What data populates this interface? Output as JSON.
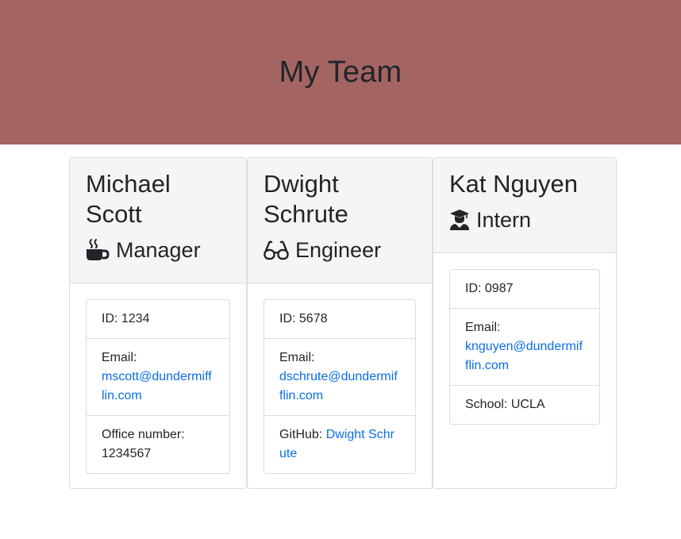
{
  "header": {
    "title": "My Team"
  },
  "employees": [
    {
      "name": "Michael Scott",
      "role": "Manager",
      "icon": "coffee-mug-icon",
      "id_text": "ID: 1234",
      "email_label": "Email:",
      "email": "mscott@dundermifflin.com",
      "extra_label": "Office number:",
      "extra_value": "1234567"
    },
    {
      "name": "Dwight Schrute",
      "role": "Engineer",
      "icon": "glasses-icon",
      "id_text": "ID: 5678",
      "email_label": "Email:",
      "email": "dschrute@dundermifflin.com",
      "extra_label": "GitHub:",
      "extra_value": "Dwight Schrute"
    },
    {
      "name": "Kat Nguyen",
      "role": "Intern",
      "icon": "graduate-icon",
      "id_text": "ID: 0987",
      "email_label": "Email:",
      "email": "knguyen@dundermifflin.com",
      "extra_label": "School:",
      "extra_value": "UCLA"
    }
  ],
  "colors": {
    "banner": "#a46462",
    "link": "#0a6ee8",
    "header_bg": "#f5f5f5"
  }
}
